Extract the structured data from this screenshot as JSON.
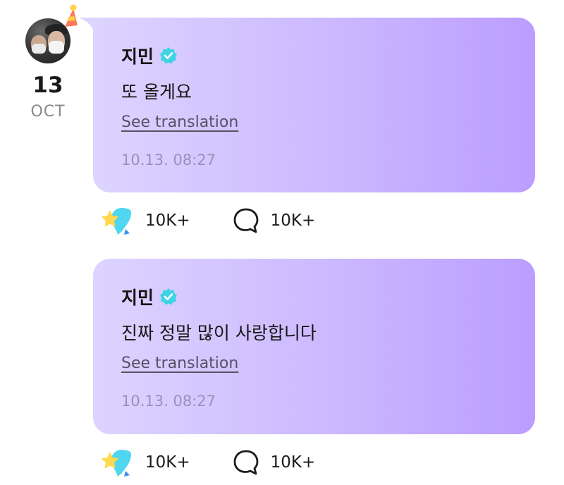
{
  "profile": {
    "avatar_alt": "avatar",
    "date_day": "13",
    "date_month": "OCT"
  },
  "posts": [
    {
      "author": "지민",
      "message": "또 올게요",
      "translate_label": "See translation",
      "timestamp": "10.13. 08:27",
      "likes": "10K+",
      "comments": "10K+"
    },
    {
      "author": "지민",
      "message": "진짜 정말 많이 사랑합니다",
      "translate_label": "See translation",
      "timestamp": "10.13. 08:27",
      "likes": "10K+",
      "comments": "10K+"
    }
  ],
  "colors": {
    "bubble_start": "#ddd4ff",
    "bubble_end": "#bb9dff",
    "verified": "#3fd3e6",
    "timestamp": "#9a90b8"
  },
  "icons": {
    "verified": "verified-badge-icon",
    "like": "star-heart-icon",
    "comment": "speech-bubble-icon",
    "hat": "party-hat-icon"
  }
}
